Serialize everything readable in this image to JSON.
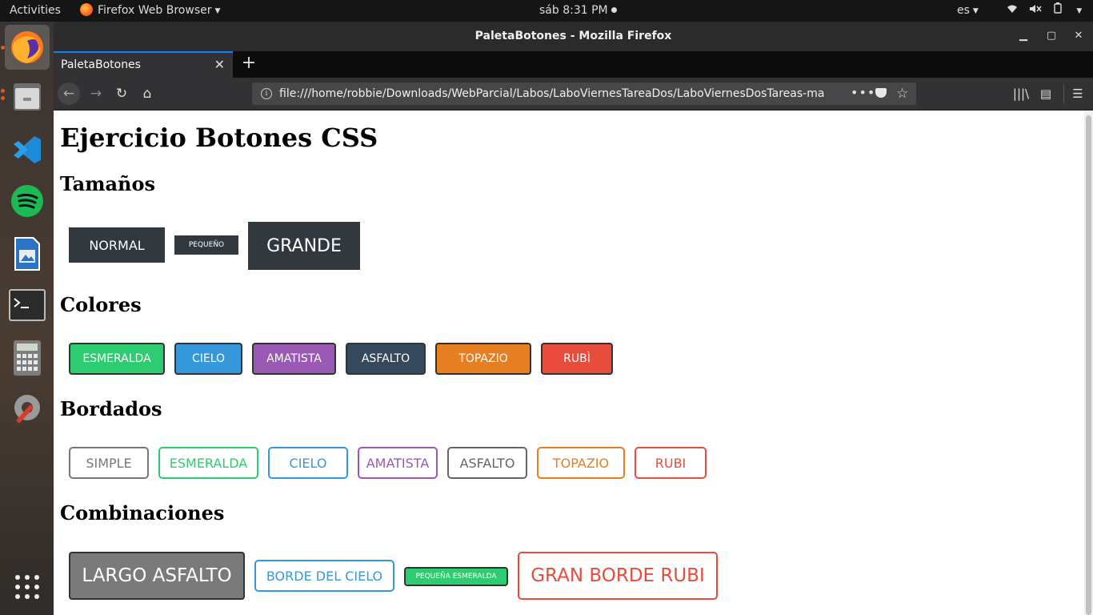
{
  "topbar": {
    "activities": "Activities",
    "app_menu": "Firefox Web Browser",
    "clock": "sáb  8:31 PM",
    "language": "es"
  },
  "window": {
    "title": "PaletaBotones - Mozilla Firefox",
    "tab_title": "PaletaBotones",
    "url": "file:///home/robbie/Downloads/WebParcial/Labos/LaboViernesTareaDos/LaboViernesDosTareas-ma"
  },
  "dock": [
    "firefox-icon",
    "files-icon",
    "vscode-icon",
    "spotify-icon",
    "writer-icon",
    "terminal-icon",
    "calculator-icon",
    "settings-icon",
    "app-grid-icon"
  ],
  "page": {
    "title": "Ejercicio Botones CSS",
    "sizes": {
      "heading": "Tamaños",
      "normal": "NORMAL",
      "small": "PEQUEÑO",
      "large": "GRANDE"
    },
    "colors": {
      "heading": "Colores",
      "buttons": [
        {
          "label": "ESMERALDA",
          "color": "#2ecc71"
        },
        {
          "label": "CIELO",
          "color": "#3498db"
        },
        {
          "label": "AMATISTA",
          "color": "#9b59b6"
        },
        {
          "label": "ASFALTO",
          "color": "#34495e"
        },
        {
          "label": "TOPAZIO",
          "color": "#e67e22"
        },
        {
          "label": "RUBÌ",
          "color": "#e74c3c"
        }
      ]
    },
    "borders": {
      "heading": "Bordados",
      "buttons": [
        {
          "label": "SIMPLE",
          "color": "#777777"
        },
        {
          "label": "ESMERALDA",
          "color": "#2ecc71"
        },
        {
          "label": "CIELO",
          "color": "#3498db"
        },
        {
          "label": "AMATISTA",
          "color": "#9b59b6"
        },
        {
          "label": "ASFALTO",
          "color": "#666666"
        },
        {
          "label": "TOPAZIO",
          "color": "#e67e22"
        },
        {
          "label": "RUBI",
          "color": "#e74c3c"
        }
      ]
    },
    "combos": {
      "heading": "Combinaciones",
      "large_asphalt": "LARGO ASFALTO",
      "sky_border": "BORDE DEL CIELO",
      "small_emerald": "PEQUEÑA ESMERALDA",
      "big_ruby_border": "GRAN BORDE RUBI"
    }
  }
}
